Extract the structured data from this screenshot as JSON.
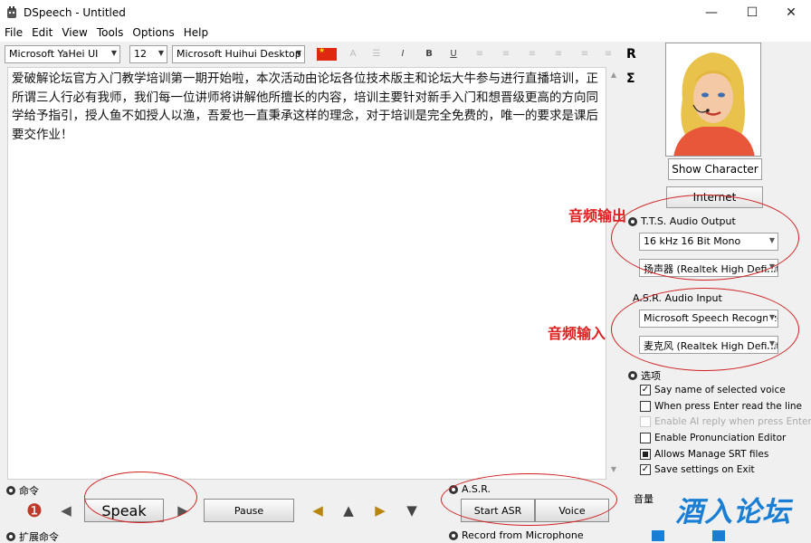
{
  "window": {
    "title": "DSpeech - Untitled",
    "controls": [
      "—",
      "☐",
      "✕"
    ]
  },
  "menu": [
    "File",
    "Edit",
    "View",
    "Tools",
    "Options",
    "Help"
  ],
  "toolbar": {
    "font_name": "Microsoft YaHei UI",
    "font_size": "12",
    "voice": "Microsoft Huihui Desktop",
    "format_buttons": [
      "A",
      "☰",
      "I",
      "B",
      "U",
      "≡",
      "≡",
      "≡",
      "≡",
      "≡",
      "≡"
    ]
  },
  "editor": {
    "text": "爱破解论坛官方入门教学培训第一期开始啦，本次活动由论坛各位技术版主和论坛大牛参与进行直播培训，正所谓三人行必有我师，我们每一位讲师将讲解他所擅长的内容，培训主要针对新手入门和想晋级更高的方向同学给予指引，授人鱼不如授人以渔，吾爱也一直秉承这样的理念，对于培训是完全免费的，唯一的要求是课后要交作业！"
  },
  "side_symbols": [
    "R",
    "Σ"
  ],
  "character": {
    "show_label": "Show Character",
    "internet_label": "Internet"
  },
  "tts_output": {
    "label": "T.T.S. Audio Output",
    "format": "16 kHz 16 Bit Mono",
    "device": "扬声器 (Realtek High Definiti"
  },
  "asr_input": {
    "label": "A.S.R. Audio Input",
    "recognizer": "Microsoft Speech Recognizer",
    "device": "麦克风 (Realtek High Definiti"
  },
  "options": {
    "label": "选项",
    "items": [
      {
        "text": "Say name of selected voice",
        "state": "checked"
      },
      {
        "text": "When press Enter read the line",
        "state": "unchecked"
      },
      {
        "text": "Enable AI reply when press Enter",
        "state": "disabled"
      },
      {
        "text": "Enable Pronunciation Editor",
        "state": "unchecked"
      },
      {
        "text": "Allows Manage SRT files",
        "state": "filled"
      },
      {
        "text": "Save settings on Exit",
        "state": "checked"
      }
    ]
  },
  "commands": {
    "label": "命令",
    "speak": "Speak",
    "pause": "Pause",
    "ext_label": "扩展命令"
  },
  "asr": {
    "label": "A.S.R.",
    "start": "Start ASR",
    "voice": "Voice",
    "record": "Record from Microphone"
  },
  "volume": {
    "label": "音量"
  },
  "annotations": {
    "output": "音频输出",
    "input": "音频输入",
    "watermark": "酒入论坛"
  },
  "colors": {
    "annotation": "#e02020",
    "watermark": "#1a7fd4"
  }
}
